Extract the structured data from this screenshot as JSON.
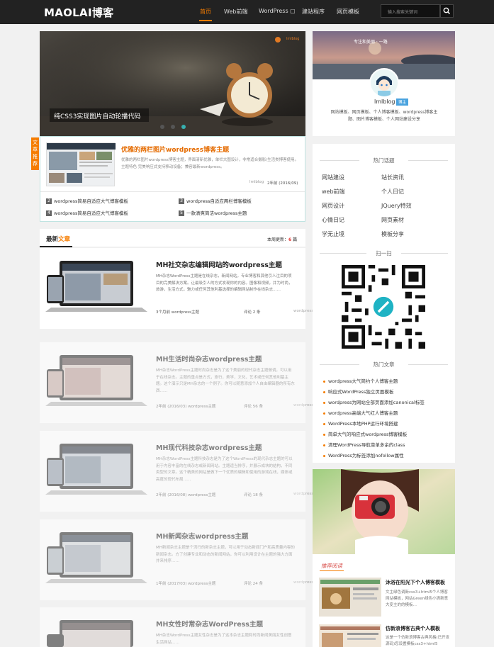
{
  "header": {
    "logo": "MAOLAI博客",
    "nav": [
      "首页",
      "Web前端",
      "WordPress ▢",
      "建站程序",
      "网页模板"
    ],
    "search_placeholder": "输入搜索关键词",
    "brand_color": "#f57c00"
  },
  "slider": {
    "caption": "纯CSS3实现图片自动轮播代码",
    "watermark": "lmlblog",
    "dots_count": 3,
    "active_dot": 3
  },
  "feature": {
    "side_label": "文章推荐",
    "title": "优雅的两栏图片wordpress博客主题",
    "excerpt": "优雅的两栏图片wordpress博客主题，界面清新优雅，单栏大图设计，非常适合摄影/生活类博客使用。主题特色 完美响应式支持移动设备；兼容最新wordpress。",
    "meta_author": "lmlblog",
    "meta_date": "2年前 (2016/09)",
    "list": [
      {
        "num": "2",
        "text": "wordpress简易自适应大气博客模板"
      },
      {
        "num": "3",
        "text": "wordpress自适应两栏博客模板"
      },
      {
        "num": "4",
        "text": "wordpress简易自适应大气博客模板"
      },
      {
        "num": "5",
        "text": "一款清爽简洁wordpress主题"
      }
    ]
  },
  "latest": {
    "title_black": "最新",
    "title_orange": "文章",
    "update_label": "本周更新：",
    "update_count": "6",
    "update_unit": "篇"
  },
  "posts": [
    {
      "title": "MH社交杂志编辑网站的wordpress主题",
      "excerpt": "MH杂志WordPress主题是在线杂志，新闻网站，专业博客和其他引人注目的项目的完美解决方案。让最吸引人的方式发现你的内容。图像和视频，并为时尚，旅游，生活方式，魅力或任何其他利基选择的编辑网站制作在线杂志……",
      "meta": "3个月前  wordpress主题",
      "comments": "评论 2 条",
      "cat": "wordpress"
    },
    {
      "title": "MH生活时尚杂志wordpress主题",
      "excerpt": "MH杂志WordPress主题时尚杂志是为了这个美丽的现代杂志主题做调，可以用于在线杂志。主题的重点是方式，旅行，美学，文化，艺术或任何其他利基主题。这个演示只是MH杂志的一个例子。你可以随意添加个人自由编辑器的所有东西……",
      "meta": "2年前 (2016/03)  wordpress主题",
      "comments": "评论 56 条",
      "cat": "wordpress"
    },
    {
      "title": "MH现代科技杂志wordpress主题",
      "excerpt": "MH杂志WordPress主题科技杂志是为了这个WordPress的现代杂志主题的可以用于内容丰富的在线杂志或新闻网站。主题适当排序，并展示成块的结构，不同类型的文章。这个精美的网站是做下一个优质的编辑和使用的游戏在线，媒体或高度的现代布局……",
      "meta": "2年前 (2016/08)  wordpress主题",
      "comments": "评论 18 条",
      "cat": "wordpress"
    },
    {
      "title": "MH新闻杂志wordpress主题",
      "excerpt": "MH新闻杂志主题是个流行的新杂志主题，可以用于动态新闻门户和高质量内容的新闻杂志。方了创建专业和动态的新闻网站，你可以利用设计在主题的强大方面并来排序……",
      "meta": "1年前 (2017/03)  wordpress主题",
      "comments": "评论 24 条",
      "cat": "wordpress"
    },
    {
      "title": "MH女性时常杂志WordPress主题",
      "excerpt": "MH杂志WordPress主题女性杂志是为了这本杂志主题和时尚新闻美丽女性创意生活网站……",
      "meta": "",
      "comments": "",
      "cat": ""
    }
  ],
  "profile": {
    "name": "lmlblog",
    "badge": "博主",
    "desc": "网站模板、网页模板、个人博客模板、wordpress博客主题、图片博客模板、个人网站建设分享"
  },
  "hot_topics": {
    "title": "热门话题",
    "tags": [
      "网站建设",
      "站长资讯",
      "web前端",
      "个人日记",
      "网页设计",
      "JQuery特效",
      "心情日记",
      "网页素材",
      "学无止境",
      "模板分享"
    ]
  },
  "qr": {
    "title": "扫一扫"
  },
  "hot_articles": {
    "title": "热门文章",
    "items": [
      "wordpress大气简约个人博客主题",
      "响应式WordPress独立页面模板",
      "wordpress为网站全部页面添加canonical标签",
      "wordpress高端大气红人博客主题",
      "WordPress本地PHP运行环境搭建",
      "简单大气的响应式wordpress博客模板",
      "清理WordPress导航菜单多余的class",
      "WordPress为标签添加nofollow属性"
    ]
  },
  "recommend": {
    "title": "推荐阅读",
    "items": [
      {
        "title": "沐浴在阳光下个人博客模板",
        "desc": "文主绿色调新css3+html5个人博客网站模板，网站Green绿色小清新意大变主的的模板…"
      },
      {
        "title": "仿新浪博客古典个人模板",
        "desc": "这是一个仿新浪博客古典风格(已开发源码)您设置模板css3+html5"
      }
    ]
  }
}
